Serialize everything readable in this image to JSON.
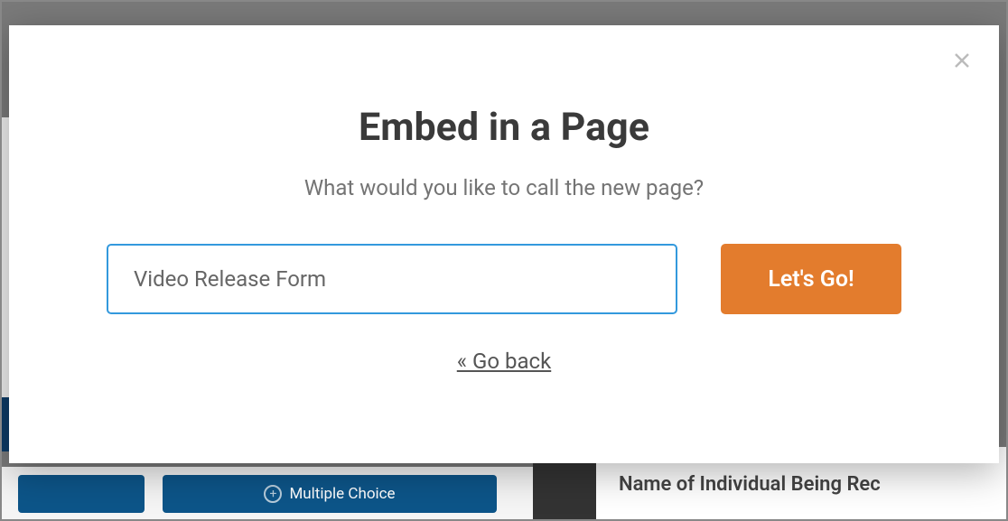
{
  "modal": {
    "title": "Embed in a Page",
    "subtitle": "What would you like to call the new page?",
    "page_name_value": "Video Release Form",
    "go_button_label": "Let's Go!",
    "go_back_label": "« Go back"
  },
  "background": {
    "button2_label": "Multiple Choice",
    "right_panel_text": "Name of Individual Being Rec"
  }
}
